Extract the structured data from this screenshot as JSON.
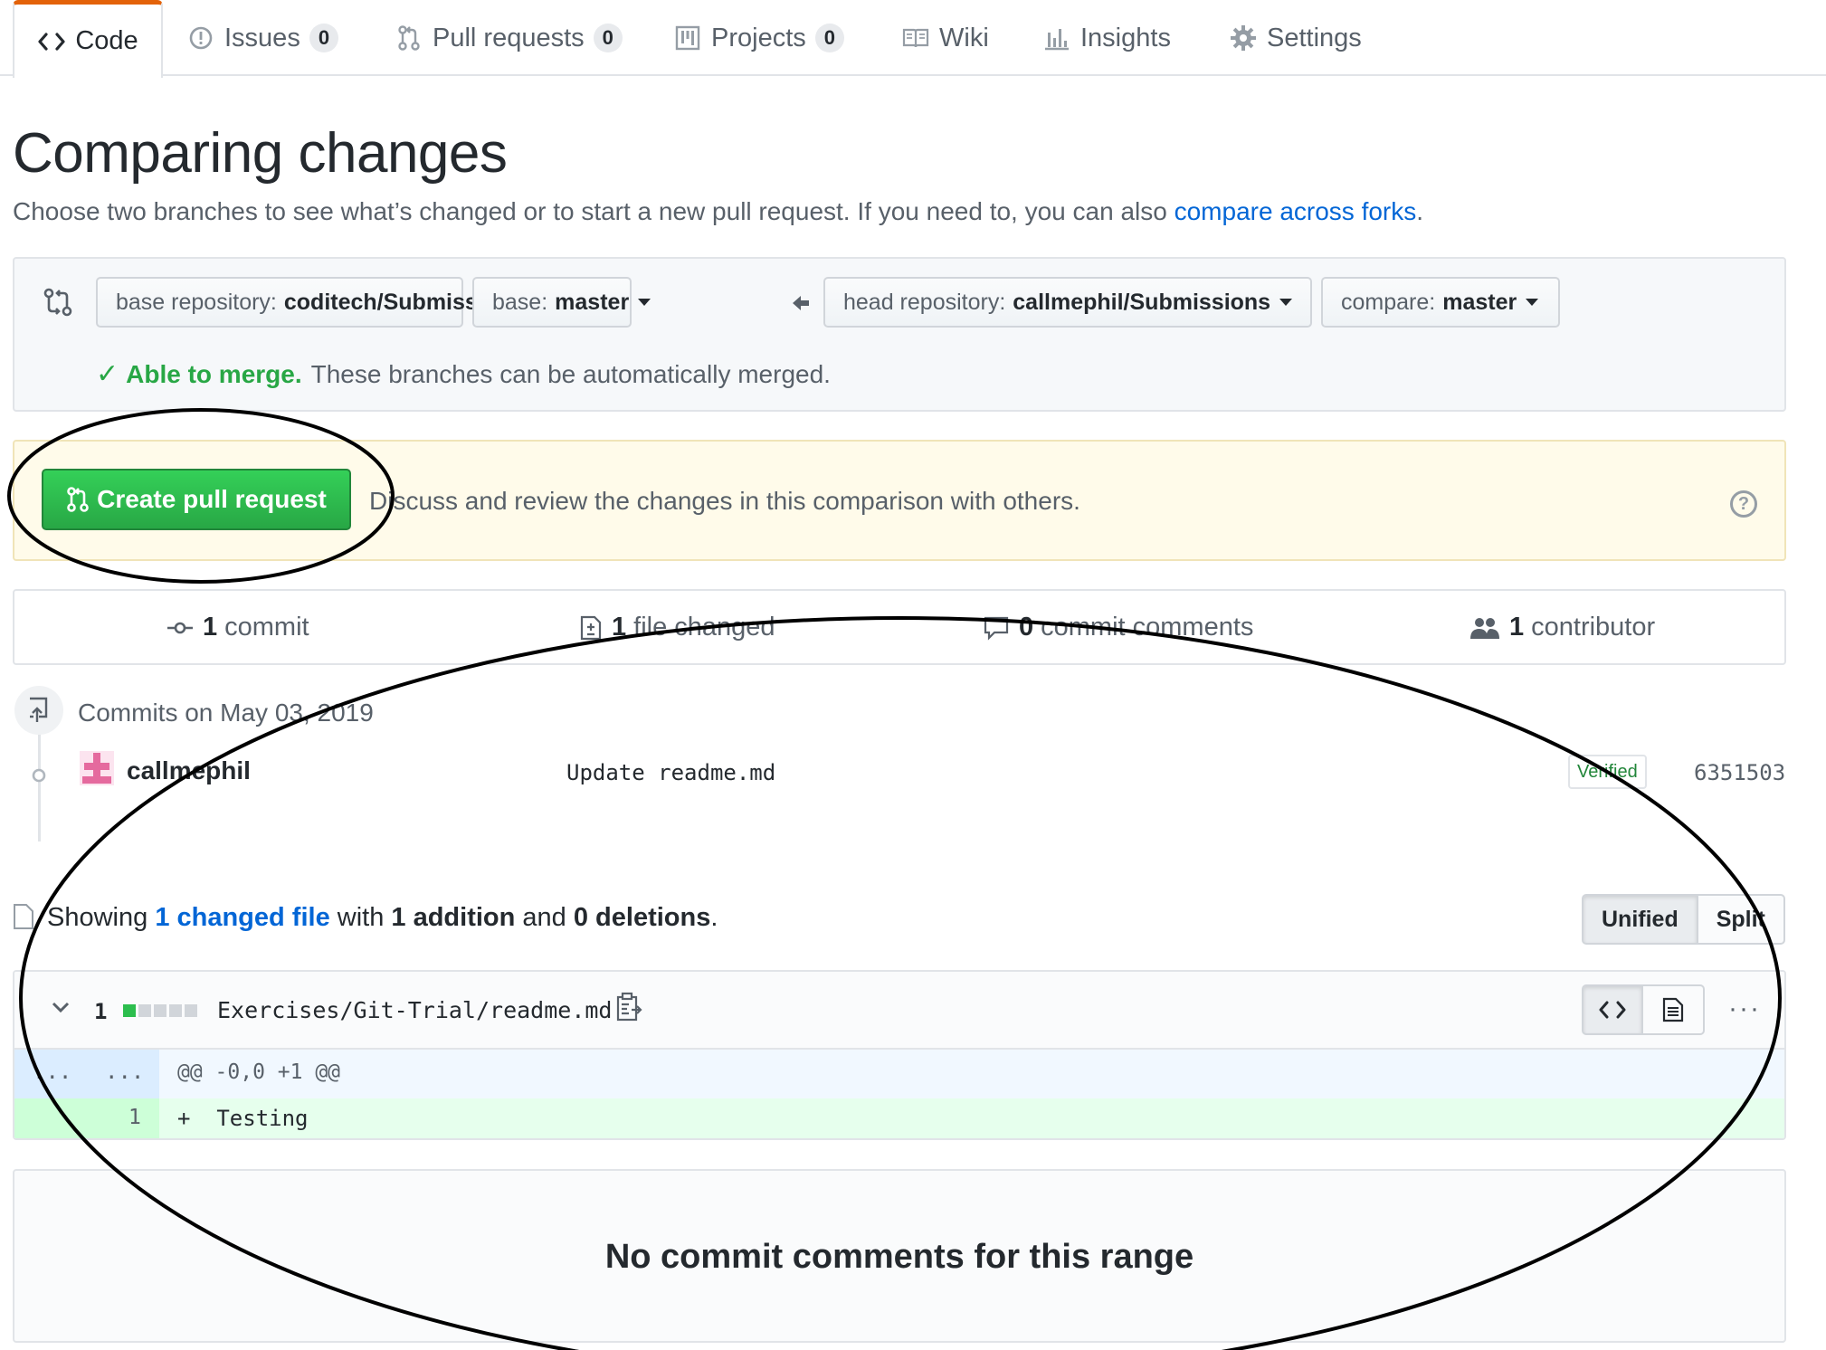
{
  "tabs": [
    {
      "label": "Code",
      "icon": "code-icon",
      "selected": true
    },
    {
      "label": "Issues",
      "icon": "issue-icon",
      "count": "0"
    },
    {
      "label": "Pull requests",
      "icon": "git-pull-request-icon",
      "count": "0"
    },
    {
      "label": "Projects",
      "icon": "project-icon",
      "count": "0"
    },
    {
      "label": "Wiki",
      "icon": "book-icon"
    },
    {
      "label": "Insights",
      "icon": "graph-icon"
    },
    {
      "label": "Settings",
      "icon": "gear-icon"
    }
  ],
  "page": {
    "title": "Comparing changes",
    "subtitle_text": "Choose two branches to see what’s changed or to start a new pull request. If you need to, you can also ",
    "subtitle_link": "compare across forks",
    "subtitle_end": "."
  },
  "range": {
    "base_repo_label": "base repository:",
    "base_repo_value": "coditech/Submissions",
    "base_label": "base:",
    "base_value": "master",
    "head_repo_label": "head repository:",
    "head_repo_value": "callmephil/Submissions",
    "compare_label": "compare:",
    "compare_value": "master",
    "merge_ok": "Able to merge.",
    "merge_text": "These branches can be automatically merged."
  },
  "pr": {
    "button_label": "Create pull request",
    "description": "Discuss and review the changes in this comparison with others.",
    "help": "?"
  },
  "summary": {
    "commits_count": "1",
    "commits_label": "commit",
    "files_count": "1",
    "files_label": "file changed",
    "comments_count": "0",
    "comments_label": "commit comments",
    "contributors_count": "1",
    "contributors_label": "contributor"
  },
  "commits": {
    "date_label": "Commits on May 03, 2019",
    "items": [
      {
        "author": "callmephil",
        "message": "Update readme.md",
        "badge": "Verified",
        "sha": "6351503"
      }
    ]
  },
  "toc": {
    "showing": "Showing",
    "changed_link": "1 changed file",
    "with": "with",
    "additions": "1 addition",
    "and": "and",
    "deletions": "0 deletions",
    "end": ".",
    "unified_label": "Unified",
    "split_label": "Split"
  },
  "file": {
    "change_count": "1",
    "path": "Exercises/Git-Trial/readme.md",
    "hunk_left": "...",
    "hunk_right": "...",
    "hunk_header": "@@ -0,0 +1 @@",
    "added_line_num": "1",
    "added_line": "+  Testing",
    "more": "···"
  },
  "blankslate": {
    "message": "No commit comments for this range"
  },
  "colors": {
    "link": "#0366d6",
    "success": "#28a745",
    "tab_accent": "#e36209",
    "annotation": "#000000"
  }
}
